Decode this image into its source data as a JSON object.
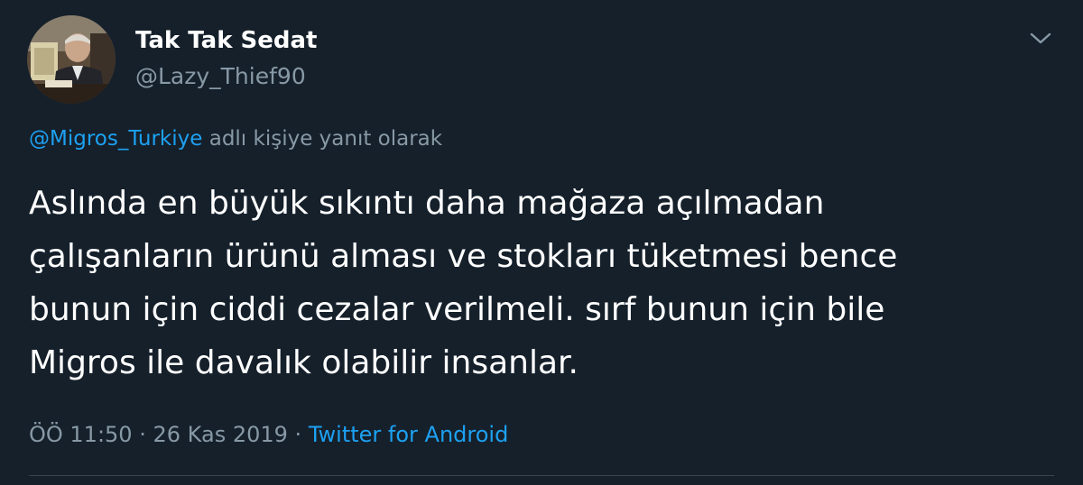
{
  "user": {
    "display_name": "Tak Tak Sedat",
    "handle": "@Lazy_Thief90",
    "avatar_icon": "profile-photo"
  },
  "reply": {
    "mention": "@Migros_Turkiye",
    "suffix": "adlı kişiye yanıt olarak"
  },
  "tweet": {
    "lines": [
      "Aslında en büyük sıkıntı daha mağaza açılmadan",
      "çalışanların ürünü alması ve stokları tüketmesi bence",
      "bunun için ciddi cezalar verilmeli. sırf bunun için bile",
      "Migros ile davalık olabilir insanlar."
    ]
  },
  "meta": {
    "time": "ÖÖ 11:50",
    "separator1": "·",
    "date": "26 Kas 2019",
    "separator2": "·",
    "source": "Twitter for Android"
  },
  "menu": {
    "icon": "chevron-down-icon"
  },
  "colors": {
    "background": "#15202b",
    "primary_text": "#ffffff",
    "secondary_text": "#8899a6",
    "link": "#1da1f2",
    "divider": "#38444d"
  }
}
